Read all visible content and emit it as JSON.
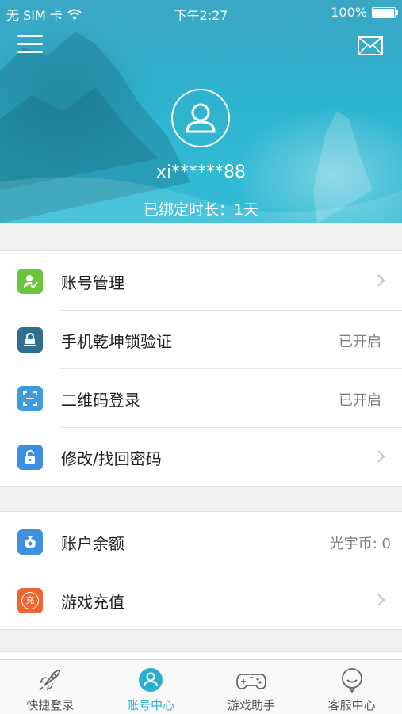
{
  "status_bar": {
    "carrier": "无 SIM 卡",
    "time": "下午2:27",
    "battery": "100%"
  },
  "header": {
    "username": "xi******88",
    "bind_duration": "已绑定时长：1天"
  },
  "groups": [
    {
      "items": [
        {
          "label": "账号管理",
          "value": "",
          "icon": "user-check-icon",
          "icon_color": "#6ac43c",
          "chevron": true
        },
        {
          "label": "手机乾坤锁验证",
          "value": "已开启",
          "icon": "lock-tray-icon",
          "icon_color": "#2f6f8d",
          "chevron": false
        },
        {
          "label": "二维码登录",
          "value": "已开启",
          "icon": "qr-scan-icon",
          "icon_color": "#3f9be0",
          "chevron": false
        },
        {
          "label": "修改/找回密码",
          "value": "",
          "icon": "padlock-icon",
          "icon_color": "#3f8fe0",
          "chevron": true
        }
      ]
    },
    {
      "items": [
        {
          "label": "账户余额",
          "value": "光宇币: 0",
          "icon": "money-bag-icon",
          "icon_color": "#3f90df",
          "chevron": false
        },
        {
          "label": "游戏充值",
          "value": "",
          "icon": "recharge-icon",
          "icon_color": "#f0652f",
          "chevron": true
        }
      ]
    }
  ],
  "tabbar": {
    "tabs": [
      {
        "label": "快捷登录",
        "icon": "rocket-icon",
        "active": false
      },
      {
        "label": "账号中心",
        "icon": "user-circle-icon",
        "active": true
      },
      {
        "label": "游戏助手",
        "icon": "gamepad-icon",
        "active": false
      },
      {
        "label": "客服中心",
        "icon": "chat-bubble-icon",
        "active": false
      }
    ]
  },
  "colors": {
    "accent": "#2ab0cc",
    "header_bg": "#33bcd6"
  },
  "recharge_icon_text": "充"
}
